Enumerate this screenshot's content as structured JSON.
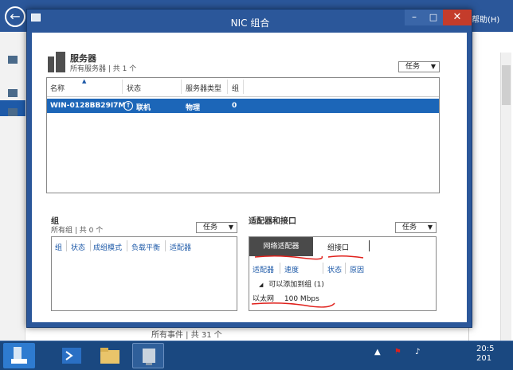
{
  "background_window": {
    "help_text": "帮助(H)",
    "events_text": "所有事件 | 共 31 个"
  },
  "dialog": {
    "title": "NIC 组合",
    "minimize_label": "–",
    "maximize_label": "□",
    "close_label": "✕"
  },
  "servers": {
    "title": "服务器",
    "subtitle": "所有服务器 | 共 1 个",
    "tasks_label": "任务",
    "columns": [
      "名称",
      "状态",
      "服务器类型",
      "组"
    ],
    "row": {
      "name": "WIN-0128BB29I7M",
      "status": "联机",
      "type": "物理",
      "teams": "0"
    }
  },
  "teams": {
    "title": "组",
    "subtitle": "所有组 | 共 0 个",
    "tasks_label": "任务",
    "columns": [
      "组",
      "状态",
      "成组模式",
      "负载平衡",
      "适配器"
    ]
  },
  "adapters": {
    "title": "适配器和接口",
    "tasks_label": "任务",
    "tab_active": "网络适配器",
    "tab_inactive": "组接口",
    "columns": [
      "适配器",
      "速度",
      "状态",
      "原因"
    ],
    "group_label": "可以添加到组 (1)",
    "group_toggle": "◢",
    "adapter_row": {
      "name": "以太网",
      "speed": "100 Mbps"
    }
  },
  "taskbar": {
    "clock_time": "20:5",
    "clock_date": "201"
  },
  "colors": {
    "accent": "#2b579a",
    "selected_row": "#1c66b8",
    "close": "#c43c2b",
    "annotation": "#e0201b"
  }
}
